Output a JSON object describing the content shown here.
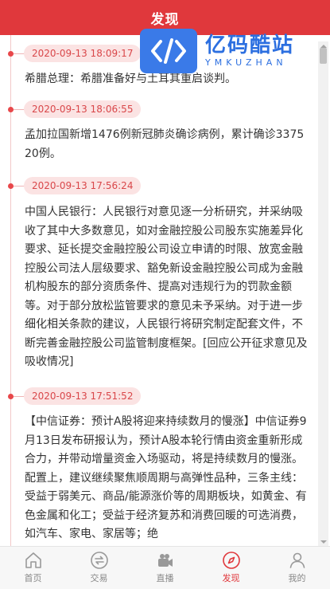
{
  "header": {
    "title": "发现"
  },
  "watermark": {
    "cn": "亿码酷站",
    "en": "YMKUZHAN"
  },
  "colors": {
    "accent": "#e0383c",
    "time_bg": "#fbe3e3",
    "time_text": "#d9474a"
  },
  "news": [
    {
      "time": "2020-09-13 18:09:17",
      "text": "希腊总理：希腊准备好与土耳其重启谈判。"
    },
    {
      "time": "2020-09-13 18:06:55",
      "text": "孟加拉国新增1476例新冠肺炎确诊病例，累计确诊337520例。"
    },
    {
      "time": "2020-09-13 17:56:24",
      "text": "中国人民银行：人民银行对意见逐一分析研究，并采纳吸收了其中大多数意见，如对金融控股公司股东实施差异化要求、延长提交金融控股公司设立申请的时限、放宽金融控股公司法人层级要求、豁免新设金融控股公司成为金融机构股东的部分资质条件、提高对违规行为的罚款金额等。对于部分放松监管要求的意见未予采纳。对于进一步细化相关条款的建议，人民银行将研究制定配套文件，不断完善金融控股公司监管制度框架。[回应公开征求意见及吸收情况]"
    },
    {
      "time": "2020-09-13 17:51:52",
      "text": "【中信证券：预计A股将迎来持续数月的慢涨】中信证券9月13日发布研报认为，预计A股本轮行情由资金重新形成合力，并带动增量资金入场驱动，将是持续数月的慢涨。配置上，建议继续聚焦顺周期与高弹性品种，三条主线：受益于弱美元、商品/能源涨价等的周期板块，如黄金、有色金属和化工；受益于经济复苏和消费回暖的可选消费，如汽车、家电、家居等；绝"
    }
  ],
  "tabs": [
    {
      "label": "首页",
      "icon": "home-icon"
    },
    {
      "label": "交易",
      "icon": "exchange-icon"
    },
    {
      "label": "直播",
      "icon": "video-camera-icon"
    },
    {
      "label": "发现",
      "icon": "compass-icon",
      "active": true
    },
    {
      "label": "我的",
      "icon": "user-icon"
    }
  ]
}
